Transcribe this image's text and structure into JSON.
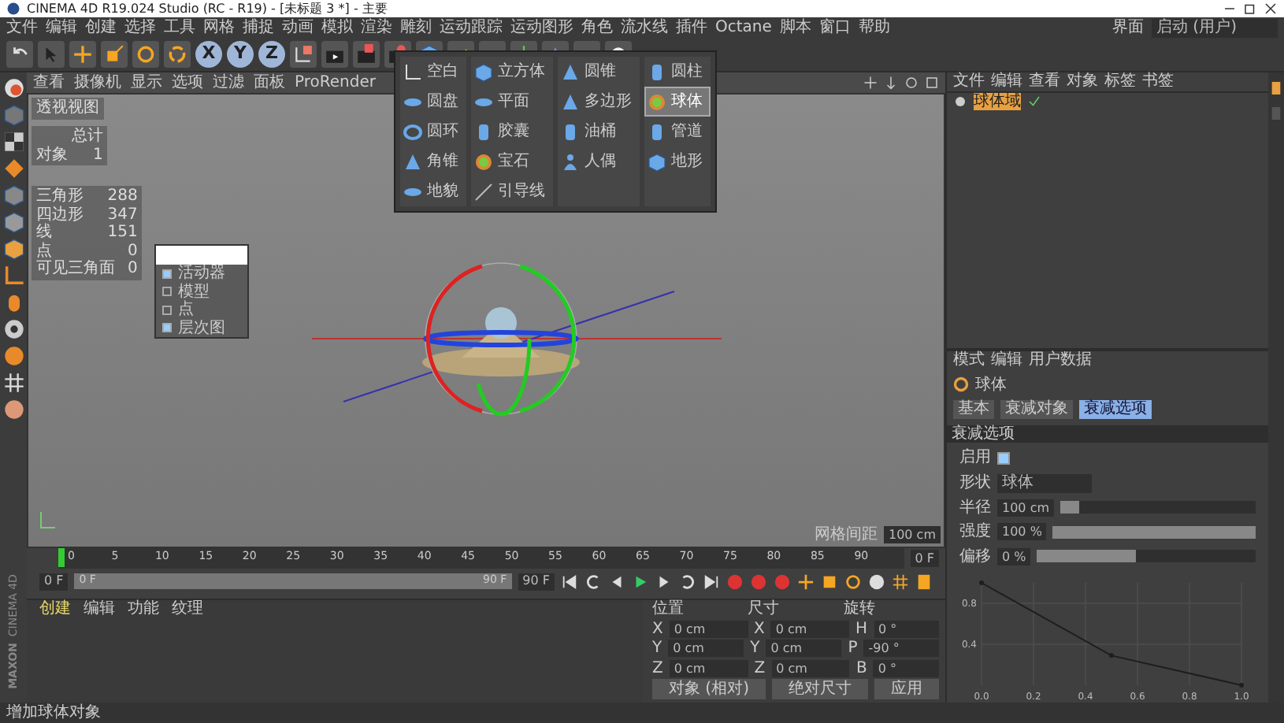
{
  "window": {
    "title": "CINEMA 4D R19.024 Studio (RC - R19) - [未标题 3 *] - 主要"
  },
  "menu": [
    "文件",
    "编辑",
    "创建",
    "选择",
    "工具",
    "网格",
    "捕捉",
    "动画",
    "模拟",
    "渲染",
    "雕刻",
    "运动跟踪",
    "运动图形",
    "角色",
    "流水线",
    "插件",
    "Octane",
    "脚本",
    "窗口",
    "帮助"
  ],
  "layout": {
    "label": "界面",
    "value": "启动 (用户)"
  },
  "axis_buttons": [
    "X",
    "Y",
    "Z"
  ],
  "primitives": [
    [
      {
        "label": "空白",
        "selected": false
      },
      {
        "label": "圆盘",
        "selected": false
      },
      {
        "label": "圆环",
        "selected": false
      },
      {
        "label": "角锥",
        "selected": false
      },
      {
        "label": "地貌",
        "selected": false
      }
    ],
    [
      {
        "label": "立方体",
        "selected": false
      },
      {
        "label": "平面",
        "selected": false
      },
      {
        "label": "胶囊",
        "selected": false
      },
      {
        "label": "宝石",
        "selected": false
      },
      {
        "label": "引导线",
        "selected": false
      }
    ],
    [
      {
        "label": "圆锥",
        "selected": false
      },
      {
        "label": "多边形",
        "selected": false
      },
      {
        "label": "油桶",
        "selected": false
      },
      {
        "label": "人偶",
        "selected": false
      }
    ],
    [
      {
        "label": "圆柱",
        "selected": false
      },
      {
        "label": "球体",
        "selected": true
      },
      {
        "label": "管道",
        "selected": false
      },
      {
        "label": "地形",
        "selected": false
      }
    ]
  ],
  "viewport": {
    "menu": [
      "查看",
      "摄像机",
      "显示",
      "选项",
      "过滤",
      "面板",
      "ProRender"
    ],
    "title": "透视视图",
    "objects_stats": {
      "header": "总计",
      "rows": [
        {
          "label": "对象",
          "value": "1"
        }
      ]
    },
    "poly_stats": [
      {
        "label": "三角形",
        "value": "288"
      },
      {
        "label": "四边形",
        "value": "347"
      },
      {
        "label": "线",
        "value": "151"
      },
      {
        "label": "点",
        "value": "0"
      },
      {
        "label": "可见三角面",
        "value": "0"
      }
    ],
    "context_menu": [
      {
        "label": "活动器",
        "checked": true
      },
      {
        "label": "模型",
        "checked": false
      },
      {
        "label": "点",
        "checked": false
      },
      {
        "label": "层次图",
        "checked": true
      }
    ],
    "grid_spacing": {
      "label": "网格间距",
      "value": "100 cm"
    }
  },
  "timeline": {
    "ticks": [
      "0",
      "5",
      "10",
      "15",
      "20",
      "25",
      "30",
      "35",
      "40",
      "45",
      "50",
      "55",
      "60",
      "65",
      "70",
      "75",
      "80",
      "85",
      "90"
    ],
    "end_field": "0 F",
    "start": "0 F",
    "range": {
      "start": "0 F",
      "end": "90 F",
      "level": 1
    },
    "end": "90 F"
  },
  "materials": {
    "tabs": [
      {
        "label": "创建",
        "selected": true
      },
      {
        "label": "编辑",
        "selected": false
      },
      {
        "label": "功能",
        "selected": false
      },
      {
        "label": "纹理",
        "selected": false
      }
    ]
  },
  "coordinates": {
    "headers": [
      "位置",
      "尺寸",
      "旋转"
    ],
    "rows": [
      [
        "X",
        "0 cm",
        "X",
        "0 cm",
        "H",
        "0 °"
      ],
      [
        "Y",
        "0 cm",
        "Y",
        "0 cm",
        "P",
        "-90 °"
      ],
      [
        "Z",
        "0 cm",
        "Z",
        "0 cm",
        "B",
        "0 °"
      ]
    ],
    "buttons": [
      "对象 (相对)",
      "绝对尺寸",
      "应用"
    ]
  },
  "object_manager": {
    "menu": [
      "文件",
      "编辑",
      "查看",
      "对象",
      "标签",
      "书签"
    ],
    "objects": [
      {
        "name": "球体域",
        "selected": true
      }
    ]
  },
  "attributes": {
    "menu": [
      "模式",
      "编辑",
      "用户数据"
    ],
    "object": "球体",
    "tabs": [
      {
        "label": "基本",
        "selected": false
      },
      {
        "label": "衰减对象",
        "selected": false
      },
      {
        "label": "衰减选项",
        "selected": true
      }
    ],
    "section": "衰减选项",
    "fields": [
      {
        "kind": "check",
        "label": "启用",
        "checked": true
      },
      {
        "kind": "dropdown",
        "label": "形状",
        "value": "球体"
      },
      {
        "kind": "slider",
        "label": "半径",
        "value": "100 cm",
        "level": 0.1
      },
      {
        "kind": "slider",
        "label": "强度",
        "value": "100 %",
        "level": 1.0
      },
      {
        "kind": "slider",
        "label": "偏移",
        "value": "0 %",
        "level": 0.45
      }
    ],
    "chart_data": {
      "type": "line",
      "x": [
        0,
        0.5,
        1
      ],
      "series": [
        {
          "color": "#1e1e1e",
          "values": [
            1,
            0.29,
            0
          ],
          "marker": true
        }
      ],
      "grid": true,
      "xlim": [
        0,
        1
      ],
      "ylim": [
        0,
        1
      ],
      "xticks": [
        {
          "value": 0,
          "label": "0.0"
        },
        {
          "value": 0.2,
          "label": "0.2"
        },
        {
          "value": 0.4,
          "label": "0.4"
        },
        {
          "value": 0.6,
          "label": "0.6"
        },
        {
          "value": 0.8,
          "label": "0.8"
        },
        {
          "value": 1,
          "label": "1.0"
        }
      ],
      "yticks": [
        {
          "value": 0.4,
          "label": "0.4"
        },
        {
          "value": 0.8,
          "label": "0.8"
        }
      ]
    }
  },
  "logo": {
    "brand": "MAXON",
    "product": "CINEMA 4D"
  },
  "status_bar": "增加球体对象"
}
